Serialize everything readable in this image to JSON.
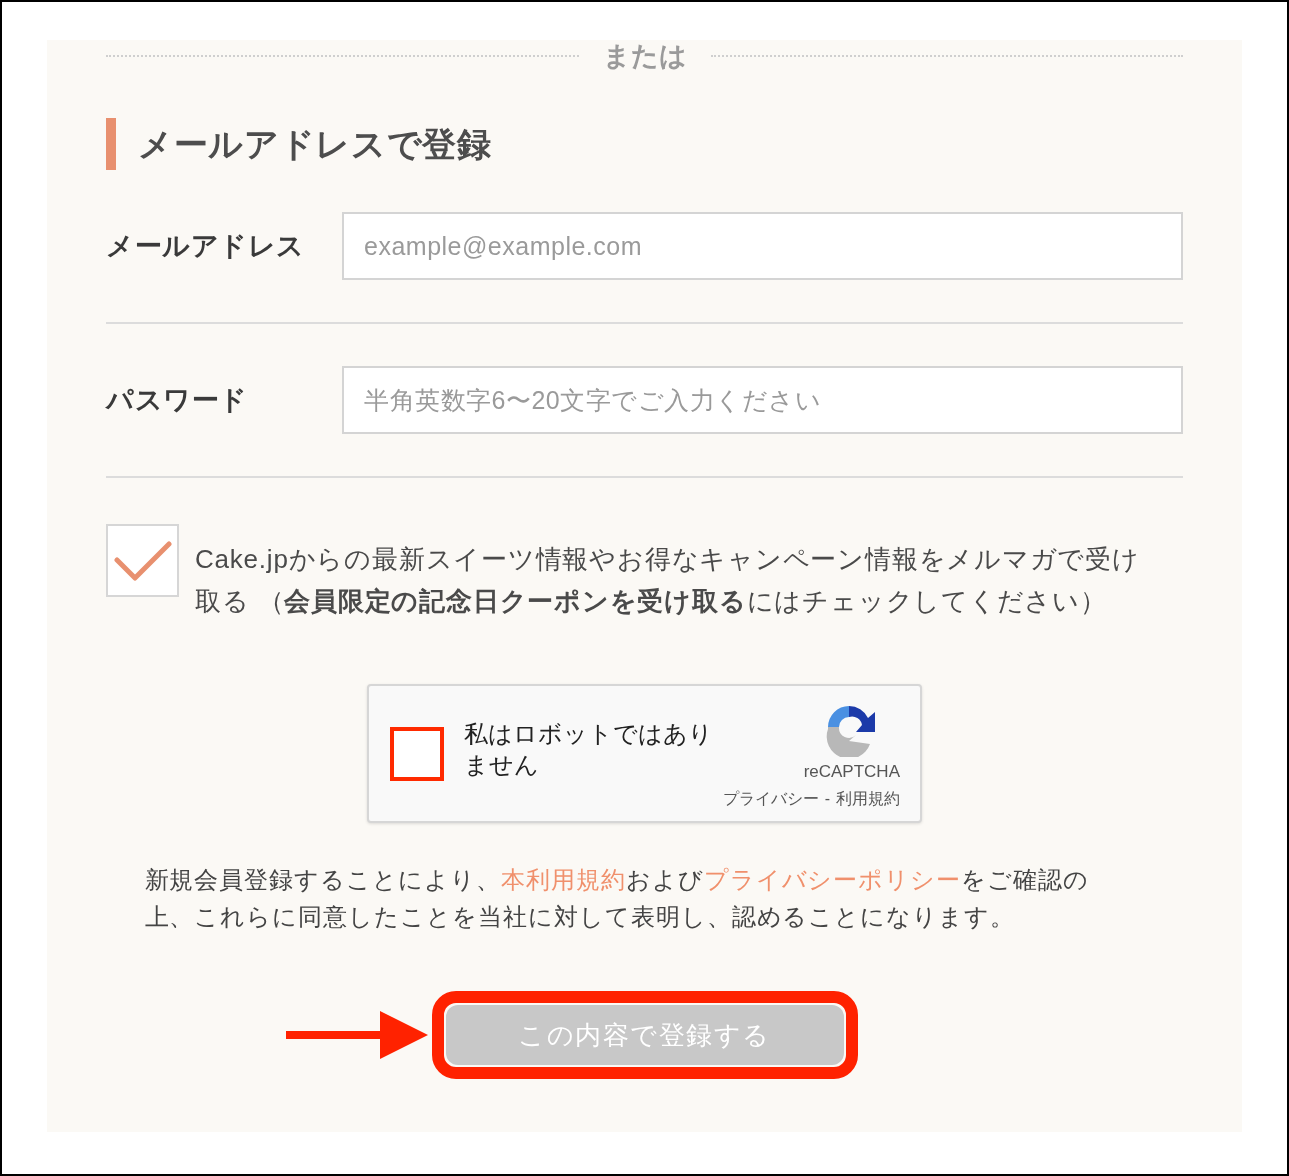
{
  "divider": {
    "label": "または"
  },
  "heading": "メールアドレスで登録",
  "fields": [
    {
      "label": "メールアドレス",
      "placeholder": "example@example.com"
    },
    {
      "label": "パスワード",
      "placeholder": "半角英数字6〜20文字でご入力ください"
    }
  ],
  "newsletter": {
    "checked": true,
    "label": "Cake.jpからの最新スイーツ情報やお得なキャンペーン情報をメルマガで受け取る （**会員限定の記念日クーポンを受け取る**にはチェックしてください）"
  },
  "recaptcha": {
    "checked": false,
    "label": "私はロボットではありません",
    "brand": "reCAPTCHA",
    "links": [
      "プライバシー",
      "利用規約"
    ],
    "separator": "-"
  },
  "notice": [
    {
      "kind": "text",
      "text": "新規会員登録することにより、"
    },
    {
      "kind": "link",
      "text": "本利用規約"
    },
    {
      "kind": "text",
      "text": "および"
    },
    {
      "kind": "link",
      "text": "プライバシーポリシー"
    },
    {
      "kind": "text",
      "text": "をご確認の上、これらに同意したことを当社に対して表明し、認めることになります。"
    }
  ],
  "submit_button": {
    "label": "この内容で登録する",
    "disabled": true,
    "highlighted": true
  }
}
